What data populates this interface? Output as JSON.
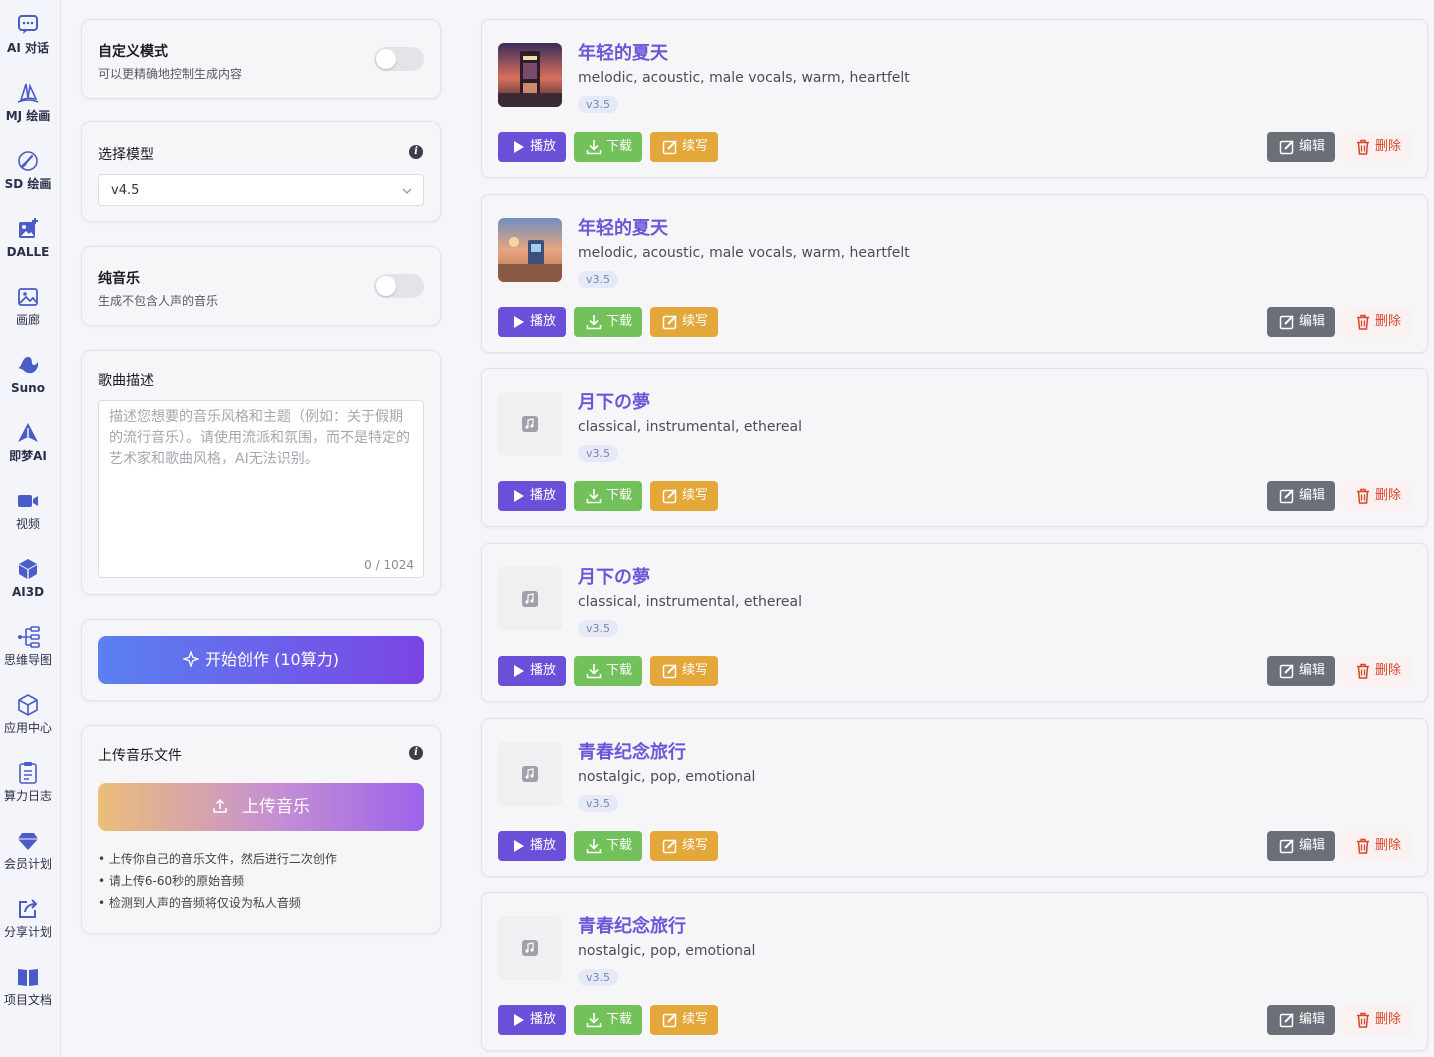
{
  "sidebar": {
    "items": [
      {
        "label": "AI 对话",
        "icon": "chat-icon"
      },
      {
        "label": "MJ 绘画",
        "icon": "sailboat-icon"
      },
      {
        "label": "SD 绘画",
        "icon": "brush-icon"
      },
      {
        "label": "DALLE",
        "icon": "image-plus-icon"
      },
      {
        "label": "画廊",
        "icon": "gallery-icon"
      },
      {
        "label": "Suno",
        "icon": "suno-wave-icon"
      },
      {
        "label": "即梦AI",
        "icon": "jimeng-icon"
      },
      {
        "label": "视频",
        "icon": "video-camera-icon"
      },
      {
        "label": "AI3D",
        "icon": "cube-icon"
      },
      {
        "label": "思维导图",
        "icon": "mindmap-icon"
      },
      {
        "label": "应用中心",
        "icon": "app-cube-icon"
      },
      {
        "label": "算力日志",
        "icon": "clipboard-icon"
      },
      {
        "label": "会员计划",
        "icon": "diamond-icon"
      },
      {
        "label": "分享计划",
        "icon": "share-icon"
      },
      {
        "label": "项目文档",
        "icon": "book-icon"
      }
    ]
  },
  "custom_mode": {
    "title": "自定义模式",
    "subtitle": "可以更精确地控制生成内容"
  },
  "model": {
    "title": "选择模型",
    "value": "v4.5"
  },
  "pure_music": {
    "title": "纯音乐",
    "subtitle": "生成不包含人声的音乐"
  },
  "description": {
    "title": "歌曲描述",
    "placeholder": "描述您想要的音乐风格和主题（例如：关于假期的流行音乐）。请使用流派和氛围，而不是特定的艺术家和歌曲风格，AI无法识别。",
    "counter": "0 / 1024"
  },
  "create": {
    "label": "开始创作 (10算力)"
  },
  "upload": {
    "title": "上传音乐文件",
    "button": "上传音乐",
    "tips": [
      "• 上传你自己的音乐文件，然后进行二次创作",
      "• 请上传6-60秒的原始音频",
      "• 检测到人声的音频将仅设为私人音频"
    ]
  },
  "actions": {
    "play": "播放",
    "download": "下载",
    "continue": "续写",
    "edit": "编辑",
    "delete": "删除"
  },
  "songs": [
    {
      "title": "年轻的夏天",
      "tags": "melodic, acoustic, male vocals, warm, heartfelt",
      "version": "v3.5",
      "cover": "arcade-sunset-cover"
    },
    {
      "title": "年轻的夏天",
      "tags": "melodic, acoustic, male vocals, warm, heartfelt",
      "version": "v3.5",
      "cover": "arcade-beach-cover"
    },
    {
      "title": "月下の夢",
      "tags": "classical, instrumental, ethereal",
      "version": "v3.5",
      "cover": "music-note-icon"
    },
    {
      "title": "月下の夢",
      "tags": "classical, instrumental, ethereal",
      "version": "v3.5",
      "cover": "music-note-icon"
    },
    {
      "title": "青春纪念旅行",
      "tags": "nostalgic, pop, emotional",
      "version": "v3.5",
      "cover": "music-note-icon"
    },
    {
      "title": "青春纪念旅行",
      "tags": "nostalgic, pop, emotional",
      "version": "v3.5",
      "cover": "music-note-icon"
    }
  ],
  "colors": {
    "accent": "#6a50d8",
    "download": "#72c15a",
    "continue": "#e3a73a",
    "edit": "#6b6f78",
    "delete": "#d9452b"
  }
}
